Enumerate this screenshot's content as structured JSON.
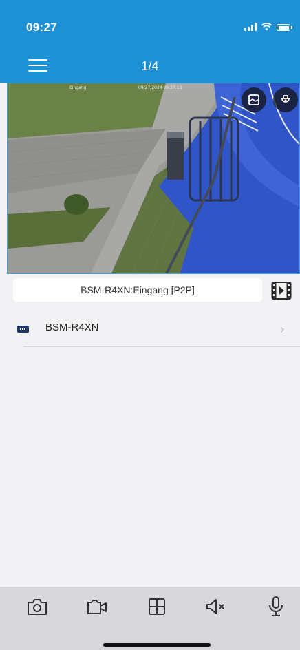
{
  "status_bar": {
    "time": "09:27"
  },
  "header": {
    "page_indicator": "1/4",
    "menu_icon": "hamburger-menu-icon",
    "background_color": "#1e90d6"
  },
  "video": {
    "overlay_buttons": [
      {
        "icon": "image-adjust-icon"
      },
      {
        "icon": "ptz-camera-icon"
      }
    ]
  },
  "channel": {
    "name": "BSM-R4XN:Eingang [P2P]",
    "playback_icon": "video-playback-icon"
  },
  "device_list": {
    "items": [
      {
        "name": "BSM-R4XN",
        "icon": "nvr-device-icon"
      }
    ]
  },
  "toolbar": {
    "buttons": [
      {
        "icon": "camera-snapshot-icon"
      },
      {
        "icon": "video-record-icon"
      },
      {
        "icon": "grid-layout-icon"
      },
      {
        "icon": "speaker-muted-icon"
      },
      {
        "icon": "microphone-icon"
      }
    ]
  }
}
